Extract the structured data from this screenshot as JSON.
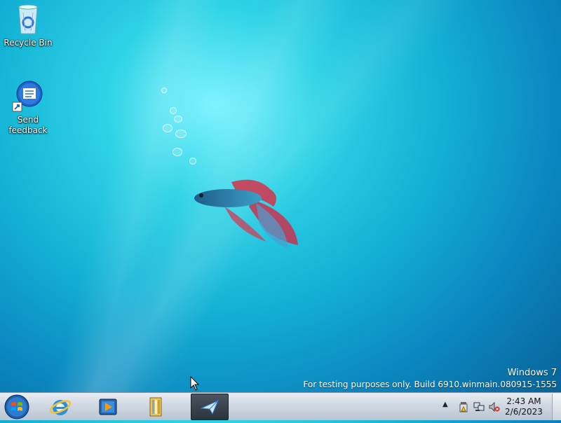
{
  "desktop": {
    "icons": [
      {
        "label": "Recycle Bin",
        "icon": "recycle-bin-icon"
      },
      {
        "label": "Send\nfeedback",
        "icon": "send-feedback-icon"
      }
    ]
  },
  "watermark": {
    "title": "Windows  7",
    "subtitle": "For testing purposes only. Build 6910.winmain.080915-1555"
  },
  "taskbar": {
    "start_icon": "windows-start-orb-icon",
    "pinned": [
      {
        "name": "internet-explorer",
        "icon": "internet-explorer-icon"
      },
      {
        "name": "media-player",
        "icon": "media-player-icon"
      },
      {
        "name": "windows-explorer",
        "icon": "folder-library-icon"
      },
      {
        "name": "send-feedback",
        "icon": "send-feedback-app-icon",
        "active": true
      }
    ],
    "tray": {
      "icons": [
        "action-center-icon",
        "network-icon",
        "volume-muted-icon"
      ],
      "time": "2:43 AM",
      "date": "2/6/2023"
    }
  },
  "colors": {
    "desktop_bg": "#14b3d6",
    "taskbar_bg": "#cfd8e2",
    "start_orb": "#1f78c8"
  }
}
